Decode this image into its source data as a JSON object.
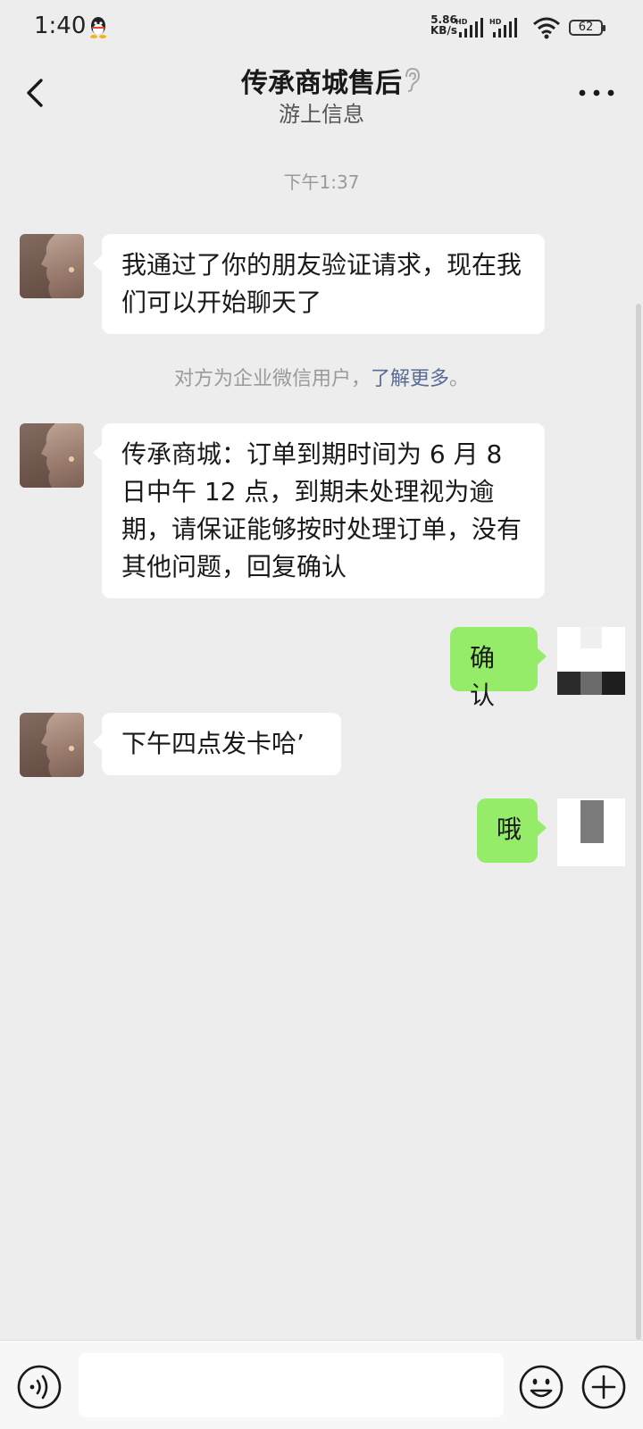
{
  "status_bar": {
    "time": "1:40",
    "speed_value": "5.86",
    "speed_unit": "KB/s",
    "signal_label": "HD",
    "battery": "62"
  },
  "header": {
    "title": "传承商城售后",
    "subtitle": "游上信息"
  },
  "chat": {
    "timestamp": "下午1:37",
    "msg1": "我通过了你的朋友验证请求，现在我们可以开始聊天了",
    "system_text": "对方为企业微信用户，",
    "system_link": "了解更多",
    "system_end": "。",
    "msg2": "传承商城：订单到期时间为 6 月 8 日中午 12 点，到期未处理视为逾期，请保证能够按时处理订单，没有其他问题，回复确认",
    "reply1": "确认",
    "msg3": "下午四点发卡哈’",
    "reply2": "哦"
  },
  "colors": {
    "background": "#ededed",
    "bubble_in": "#ffffff",
    "bubble_out": "#95ec69",
    "link": "#576b95"
  }
}
